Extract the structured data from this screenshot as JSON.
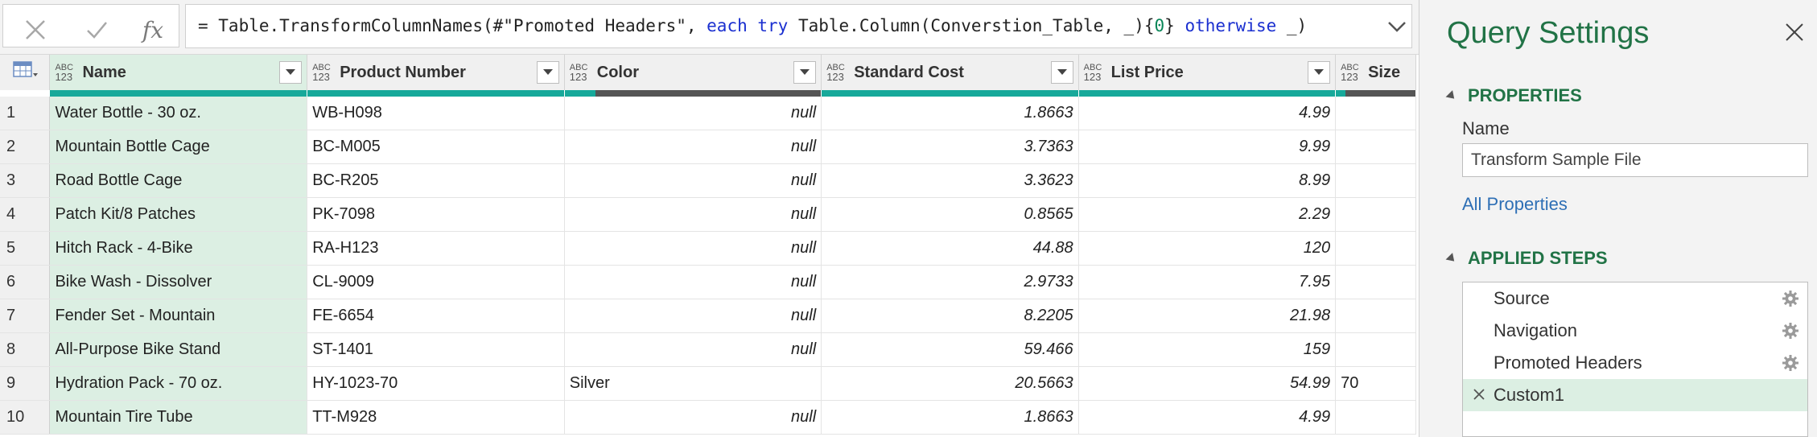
{
  "formula_bar": {
    "cancel_icon": "x-icon",
    "confirm_icon": "check-icon",
    "fx_label": "fx",
    "formula_parts": [
      {
        "text": "= Table.TransformColumnNames(#\"Promoted Headers\", ",
        "kind": "plain"
      },
      {
        "text": "each",
        "kind": "kw"
      },
      {
        "text": " ",
        "kind": "plain"
      },
      {
        "text": "try",
        "kind": "kw"
      },
      {
        "text": " Table.Column(Converstion_Table, _){",
        "kind": "plain"
      },
      {
        "text": "0",
        "kind": "num"
      },
      {
        "text": "} ",
        "kind": "plain"
      },
      {
        "text": "otherwise",
        "kind": "kw"
      },
      {
        "text": " _)",
        "kind": "plain"
      }
    ]
  },
  "grid": {
    "columns": [
      {
        "name": "Name",
        "type_top": "ABC",
        "type_bottom": "123",
        "quality_color": "#17a99a"
      },
      {
        "name": "Product Number",
        "type_top": "ABC",
        "type_bottom": "123",
        "quality_color": "#17a99a"
      },
      {
        "name": "Color",
        "type_top": "ABC",
        "type_bottom": "123",
        "quality_color": "mixed"
      },
      {
        "name": "Standard Cost",
        "type_top": "ABC",
        "type_bottom": "123",
        "quality_color": "#17a99a"
      },
      {
        "name": "List Price",
        "type_top": "ABC",
        "type_bottom": "123",
        "quality_color": "#17a99a"
      },
      {
        "name": "Size",
        "type_top": "ABC",
        "type_bottom": "123",
        "quality_color": "mixed"
      }
    ],
    "rows": [
      {
        "n": "1",
        "name": "Water Bottle - 30 oz.",
        "product": "WB-H098",
        "color": "null",
        "cost": "1.8663",
        "price": "4.99",
        "size": ""
      },
      {
        "n": "2",
        "name": "Mountain Bottle Cage",
        "product": "BC-M005",
        "color": "null",
        "cost": "3.7363",
        "price": "9.99",
        "size": ""
      },
      {
        "n": "3",
        "name": "Road Bottle Cage",
        "product": "BC-R205",
        "color": "null",
        "cost": "3.3623",
        "price": "8.99",
        "size": ""
      },
      {
        "n": "4",
        "name": "Patch Kit/8 Patches",
        "product": "PK-7098",
        "color": "null",
        "cost": "0.8565",
        "price": "2.29",
        "size": ""
      },
      {
        "n": "5",
        "name": "Hitch Rack - 4-Bike",
        "product": "RA-H123",
        "color": "null",
        "cost": "44.88",
        "price": "120",
        "size": ""
      },
      {
        "n": "6",
        "name": "Bike Wash - Dissolver",
        "product": "CL-9009",
        "color": "null",
        "cost": "2.9733",
        "price": "7.95",
        "size": ""
      },
      {
        "n": "7",
        "name": "Fender Set - Mountain",
        "product": "FE-6654",
        "color": "null",
        "cost": "8.2205",
        "price": "21.98",
        "size": ""
      },
      {
        "n": "8",
        "name": "All-Purpose Bike Stand",
        "product": "ST-1401",
        "color": "null",
        "cost": "59.466",
        "price": "159",
        "size": ""
      },
      {
        "n": "9",
        "name": "Hydration Pack - 70 oz.",
        "product": "HY-1023-70",
        "color": "Silver",
        "cost": "20.5663",
        "price": "54.99",
        "size": "70"
      },
      {
        "n": "10",
        "name": "Mountain Tire Tube",
        "product": "TT-M928",
        "color": "null",
        "cost": "1.8663",
        "price": "4.99",
        "size": ""
      }
    ]
  },
  "panel": {
    "title": "Query Settings",
    "properties_heading": "PROPERTIES",
    "name_label": "Name",
    "name_value": "Transform Sample File",
    "all_properties": "All Properties",
    "applied_steps_heading": "APPLIED STEPS",
    "steps": [
      {
        "label": "Source",
        "gear": true,
        "active": false
      },
      {
        "label": "Navigation",
        "gear": true,
        "active": false
      },
      {
        "label": "Promoted Headers",
        "gear": true,
        "active": false
      },
      {
        "label": "Custom1",
        "gear": false,
        "active": true
      }
    ]
  },
  "colors": {
    "accent_green": "#217346",
    "quality_teal": "#17a99a",
    "selected_column": "#dcefe3"
  }
}
